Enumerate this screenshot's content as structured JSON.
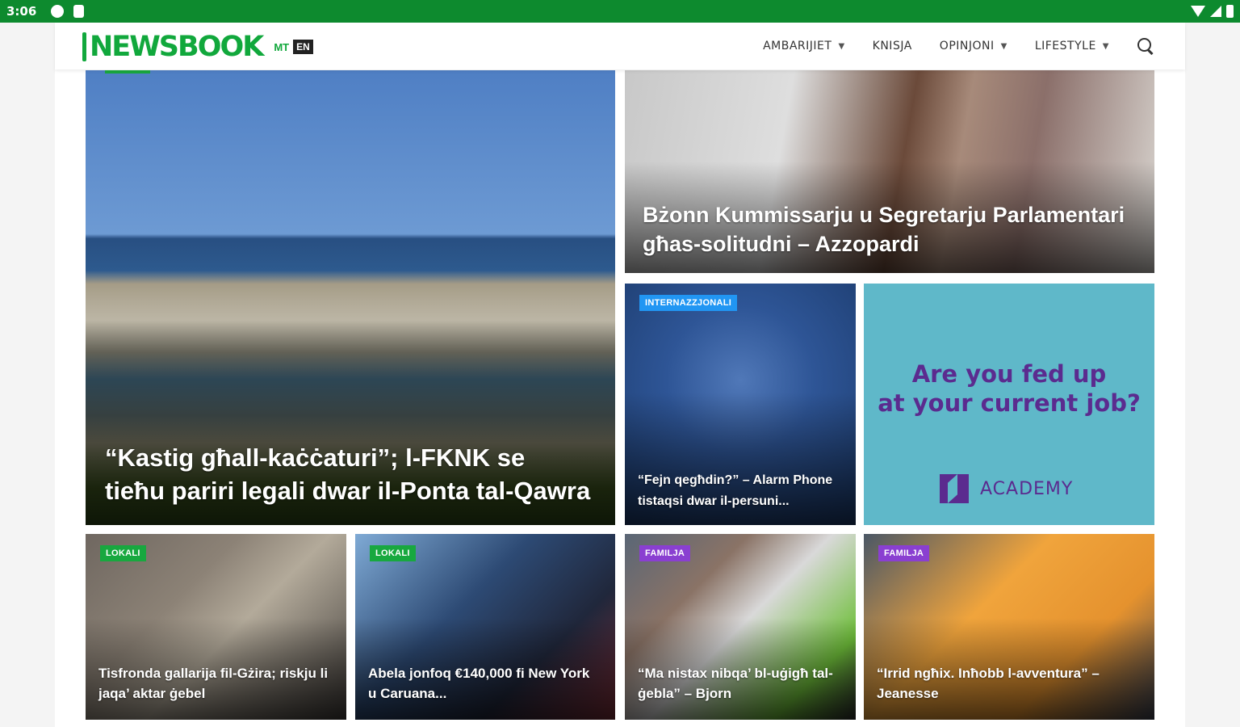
{
  "status_bar": {
    "time": "3:06"
  },
  "header": {
    "logo": "NEWSBOOK",
    "lang_mt": "MT",
    "lang_en": "EN",
    "nav": [
      {
        "label": "AMBARIJIET",
        "dropdown": true
      },
      {
        "label": "KNISJA",
        "dropdown": false
      },
      {
        "label": "OPINJONI",
        "dropdown": true
      },
      {
        "label": "LIFESTYLE",
        "dropdown": true
      }
    ]
  },
  "articles": {
    "hero": {
      "title": "“Kastig għall-kaċċaturi”; l-FKNK se tieħu pariri legali dwar il-Ponta tal-Qawra"
    },
    "top_right": {
      "title": "Bżonn Kummissarju u Segretarju Parlamentari għas-solitudni – Azzopardi"
    },
    "boat": {
      "badge": "INTERNAZZJONALI",
      "title": "“Fejn qegħdin?” – Alarm Phone tistaqsi dwar il-persuni..."
    },
    "row3": [
      {
        "badge": "LOKALI",
        "badge_type": "lokali",
        "title": "Tisfronda gallarija fil-Gżira; riskju li jaqa’ aktar ġebel"
      },
      {
        "badge": "LOKALI",
        "badge_type": "lokali",
        "title": "Abela jonfoq €140,000 fi New York u Caruana..."
      },
      {
        "badge": "FAMILJA",
        "badge_type": "familja",
        "title": "“Ma nistax nibqa’ bl-uġigħ tal-ġebla” – Bjorn"
      },
      {
        "badge": "FAMILJA",
        "badge_type": "familja",
        "title": "“Irrid ngħix. Inħobb l-avventura” – Jeanesse"
      }
    ]
  },
  "ad": {
    "headline_line1": "Are you fed up",
    "headline_line2": "at your current job?",
    "brand": "ACADEMY"
  },
  "colors": {
    "brand_green": "#11a83c",
    "status_green": "#0d8a2e",
    "familja_purple": "#8a3fd1",
    "ad_bg": "#5fb8c9",
    "ad_text": "#5b2b8f"
  }
}
